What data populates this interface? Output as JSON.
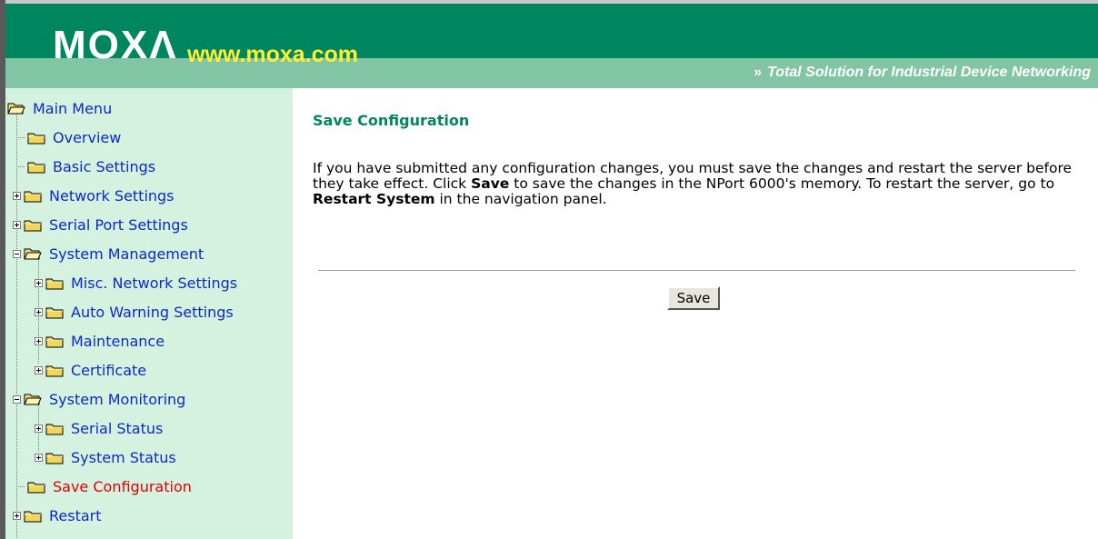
{
  "header": {
    "logo": "MOXΛ",
    "site": "www.moxa.com",
    "tagline_chevrons": "»",
    "tagline": "Total Solution for Industrial Device Networking"
  },
  "sidebar": {
    "items": [
      {
        "label": "Main Menu",
        "state": "open"
      },
      {
        "label": "Overview",
        "state": "leaf"
      },
      {
        "label": "Basic Settings",
        "state": "leaf"
      },
      {
        "label": "Network Settings",
        "state": "collapsed"
      },
      {
        "label": "Serial Port Settings",
        "state": "collapsed"
      },
      {
        "label": "System Management",
        "state": "open"
      },
      {
        "label": "Misc. Network Settings",
        "state": "collapsed"
      },
      {
        "label": "Auto Warning Settings",
        "state": "collapsed"
      },
      {
        "label": "Maintenance",
        "state": "collapsed"
      },
      {
        "label": "Certificate",
        "state": "collapsed"
      },
      {
        "label": "System Monitoring",
        "state": "open"
      },
      {
        "label": "Serial Status",
        "state": "collapsed"
      },
      {
        "label": "System Status",
        "state": "collapsed"
      },
      {
        "label": "Save Configuration",
        "state": "leaf",
        "active": true
      },
      {
        "label": "Restart",
        "state": "collapsed"
      }
    ]
  },
  "main": {
    "title": "Save Configuration",
    "desc": {
      "p1": "If you have submitted any configuration changes, you must save the changes and restart the server before they take effect. Click ",
      "b1": "Save",
      "p2": " to save the changes in the NPort 6000's memory. To restart the server, go to ",
      "b2": "Restart System",
      "p3": " in the navigation panel."
    },
    "save_label": "Save"
  },
  "colors": {
    "header_green": "#00865f",
    "header_band": "#82c5a4",
    "sidebar_bg": "#d4f2df",
    "link_blue": "#0d29c7",
    "active_red": "#e00000",
    "title_green": "#008562",
    "site_yellow": "#ffee33"
  },
  "icons": [
    "folder-icon",
    "folder-open-icon",
    "expand-plus-icon",
    "collapse-minus-icon"
  ]
}
